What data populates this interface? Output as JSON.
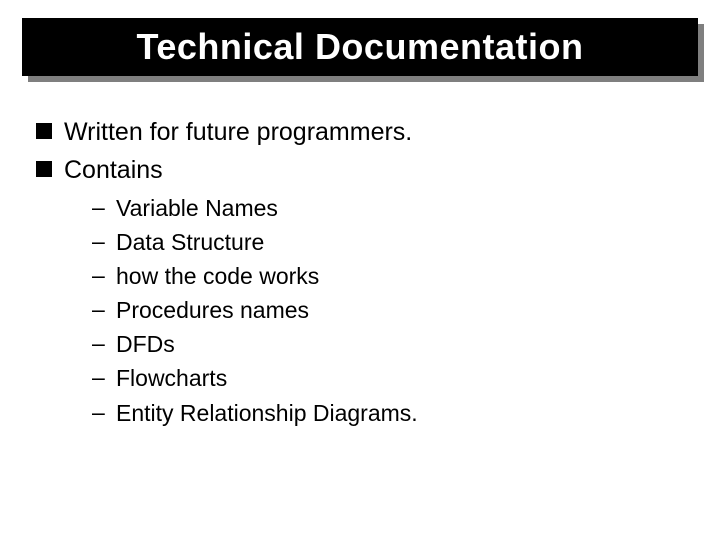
{
  "title": "Technical Documentation",
  "bullets": [
    {
      "text": "Written for future programmers."
    },
    {
      "text": "Contains"
    }
  ],
  "subitems": [
    "Variable Names",
    "Data Structure",
    "how the code works",
    "Procedures names",
    "DFDs",
    "Flowcharts",
    "Entity Relationship Diagrams."
  ]
}
